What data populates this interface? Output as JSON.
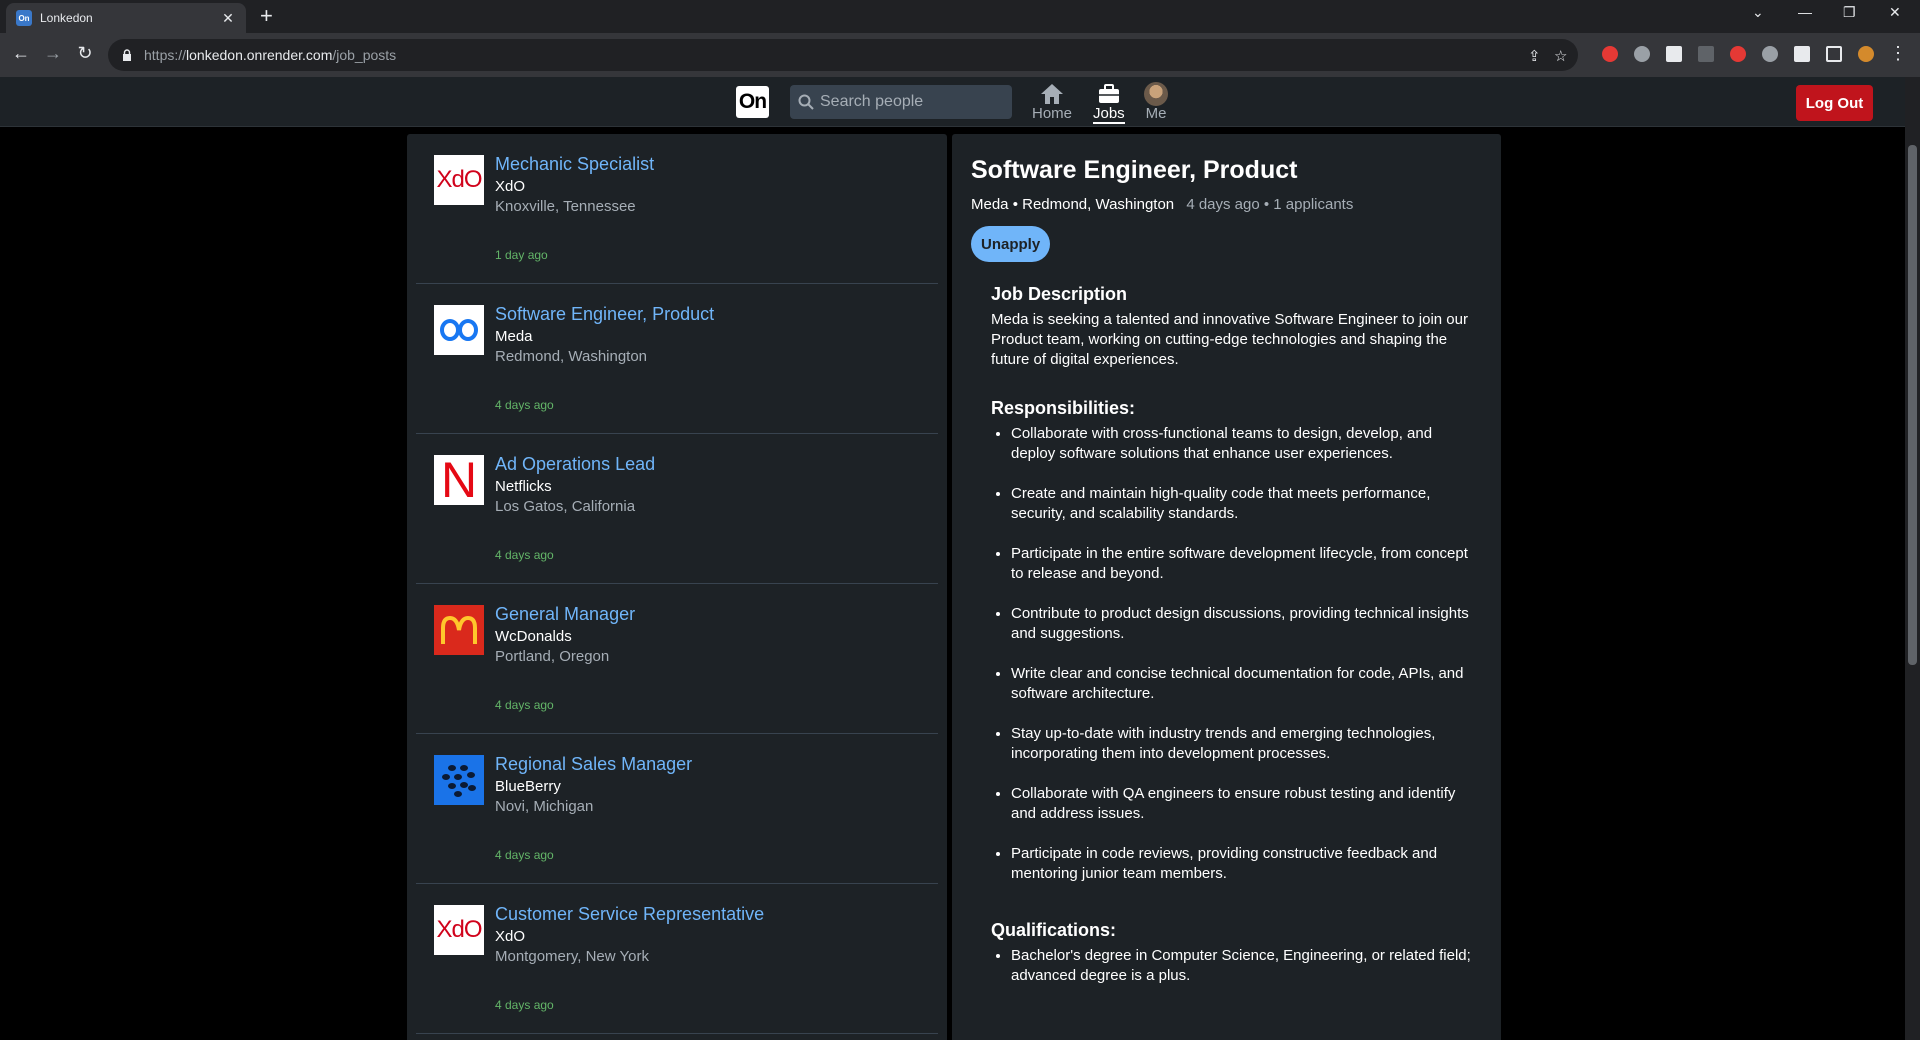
{
  "browser": {
    "tab_title": "Lonkedon",
    "url_scheme": "https://",
    "url_host": "lonkedon.onrender.com",
    "url_path": "/job_posts"
  },
  "app": {
    "logo_text": "On",
    "search_placeholder": "Search people",
    "nav": {
      "home": "Home",
      "jobs": "Jobs",
      "me": "Me"
    },
    "logout_label": "Log Out"
  },
  "jobs": [
    {
      "title": "Mechanic Specialist",
      "company": "XdO",
      "location": "Knoxville, Tennessee",
      "posted": "1 day ago",
      "logo": "XdO",
      "logo_color": "#d0021b",
      "logo_icon": "xdo-logo-icon"
    },
    {
      "title": "Software Engineer, Product",
      "company": "Meda",
      "location": "Redmond, Washington",
      "posted": "4 days ago",
      "logo": "",
      "logo_color": "#1877f2",
      "logo_icon": "meda-infinity-logo-icon"
    },
    {
      "title": "Ad Operations Lead",
      "company": "Netflicks",
      "location": "Los Gatos, California",
      "posted": "4 days ago",
      "logo": "N",
      "logo_color": "#e50914",
      "logo_icon": "netflicks-logo-icon"
    },
    {
      "title": "General Manager",
      "company": "WcDonalds",
      "location": "Portland, Oregon",
      "posted": "4 days ago",
      "logo": "",
      "logo_color": "#ffc72c",
      "logo_icon": "wcdonalds-arches-logo-icon"
    },
    {
      "title": "Regional Sales Manager",
      "company": "BlueBerry",
      "location": "Novi, Michigan",
      "posted": "4 days ago",
      "logo": "",
      "logo_color": "#1a73e8",
      "logo_icon": "blueberry-logo-icon"
    },
    {
      "title": "Customer Service Representative",
      "company": "XdO",
      "location": "Montgomery, New York",
      "posted": "4 days ago",
      "logo": "XdO",
      "logo_color": "#d0021b",
      "logo_icon": "xdo-logo-icon"
    }
  ],
  "detail": {
    "title": "Software Engineer, Product",
    "company_location": "Meda • Redmond, Washington",
    "posted_applicants": "4 days ago • 1 applicants",
    "unapply_label": "Unapply",
    "desc_heading": "Job Description",
    "desc_text": "Meda is seeking a talented and innovative Software Engineer to join our Product team, working on cutting-edge technologies and shaping the future of digital experiences.",
    "resp_heading": "Responsibilities:",
    "responsibilities": [
      "Collaborate with cross-functional teams to design, develop, and deploy software solutions that enhance user experiences.",
      "Create and maintain high-quality code that meets performance, security, and scalability standards.",
      "Participate in the entire software development lifecycle, from concept to release and beyond.",
      "Contribute to product design discussions, providing technical insights and suggestions.",
      "Write clear and concise technical documentation for code, APIs, and software architecture.",
      "Stay up-to-date with industry trends and emerging technologies, incorporating them into development processes.",
      "Collaborate with QA engineers to ensure robust testing and identify and address issues.",
      "Participate in code reviews, providing constructive feedback and mentoring junior team members."
    ],
    "qual_heading": "Qualifications:",
    "qualifications": [
      "Bachelor's degree in Computer Science, Engineering, or related field; advanced degree is a plus."
    ]
  },
  "colors": {
    "link": "#70b5f9",
    "posted_green": "#63b568",
    "logout_red": "#c0141c",
    "panel_bg": "#1d2226"
  }
}
